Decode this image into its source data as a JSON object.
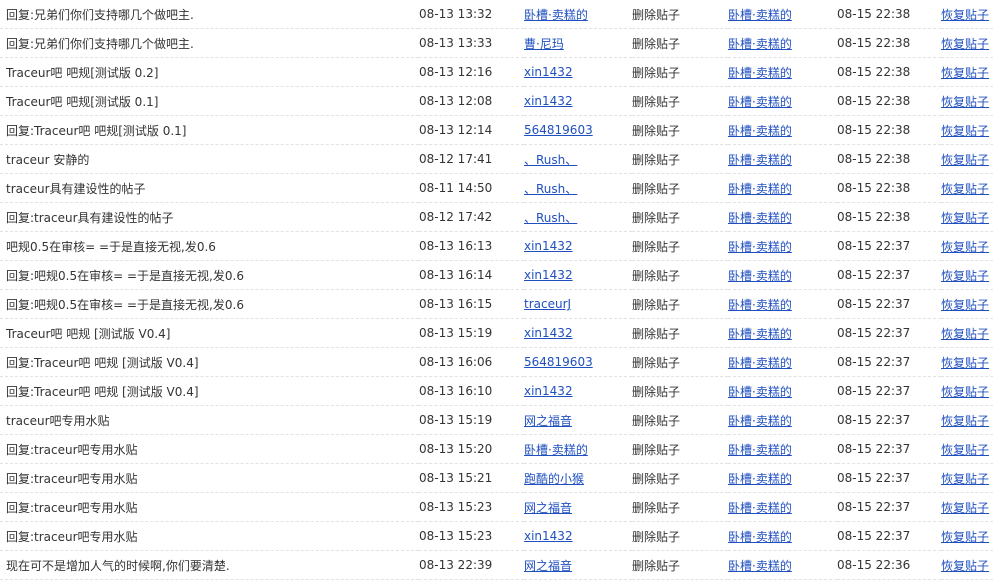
{
  "rows": [
    {
      "title": "回复:兄弟们你们支持哪几个做吧主.",
      "post_time": "08-13 13:32",
      "author": "卧槽·卖糕的",
      "action": "删除贴子",
      "operator": "卧槽·卖糕的",
      "op_time": "08-15 22:38",
      "restore": "恢复贴子"
    },
    {
      "title": "回复:兄弟们你们支持哪几个做吧主.",
      "post_time": "08-13 13:33",
      "author": "曹·尼玛",
      "action": "删除贴子",
      "operator": "卧槽·卖糕的",
      "op_time": "08-15 22:38",
      "restore": "恢复贴子"
    },
    {
      "title": "Traceur吧 吧规[测试版 0.2]",
      "post_time": "08-13 12:16",
      "author": "xin1432",
      "action": "删除贴子",
      "operator": "卧槽·卖糕的",
      "op_time": "08-15 22:38",
      "restore": "恢复贴子"
    },
    {
      "title": "Traceur吧 吧规[测试版 0.1]",
      "post_time": "08-13 12:08",
      "author": "xin1432",
      "action": "删除贴子",
      "operator": "卧槽·卖糕的",
      "op_time": "08-15 22:38",
      "restore": "恢复贴子"
    },
    {
      "title": "回复:Traceur吧 吧规[测试版 0.1]",
      "post_time": "08-13 12:14",
      "author": "564819603",
      "action": "删除贴子",
      "operator": "卧槽·卖糕的",
      "op_time": "08-15 22:38",
      "restore": "恢复贴子"
    },
    {
      "title": "traceur 安静的",
      "post_time": "08-12 17:41",
      "author": "、Rush、",
      "action": "删除贴子",
      "operator": "卧槽·卖糕的",
      "op_time": "08-15 22:38",
      "restore": "恢复贴子"
    },
    {
      "title": "traceur具有建设性的帖子",
      "post_time": "08-11 14:50",
      "author": "、Rush、",
      "action": "删除贴子",
      "operator": "卧槽·卖糕的",
      "op_time": "08-15 22:38",
      "restore": "恢复贴子"
    },
    {
      "title": "回复:traceur具有建设性的帖子",
      "post_time": "08-12 17:42",
      "author": "、Rush、",
      "action": "删除贴子",
      "operator": "卧槽·卖糕的",
      "op_time": "08-15 22:38",
      "restore": "恢复贴子"
    },
    {
      "title": "吧规0.5在审核= =于是直接无视,发0.6",
      "post_time": "08-13 16:13",
      "author": "xin1432",
      "action": "删除贴子",
      "operator": "卧槽·卖糕的",
      "op_time": "08-15 22:37",
      "restore": "恢复贴子"
    },
    {
      "title": "回复:吧规0.5在审核= =于是直接无视,发0.6",
      "post_time": "08-13 16:14",
      "author": "xin1432",
      "action": "删除贴子",
      "operator": "卧槽·卖糕的",
      "op_time": "08-15 22:37",
      "restore": "恢复贴子"
    },
    {
      "title": "回复:吧规0.5在审核= =于是直接无视,发0.6",
      "post_time": "08-13 16:15",
      "author": "traceurJ",
      "action": "删除贴子",
      "operator": "卧槽·卖糕的",
      "op_time": "08-15 22:37",
      "restore": "恢复贴子"
    },
    {
      "title": "Traceur吧 吧规 [测试版 V0.4]",
      "post_time": "08-13 15:19",
      "author": "xin1432",
      "action": "删除贴子",
      "operator": "卧槽·卖糕的",
      "op_time": "08-15 22:37",
      "restore": "恢复贴子"
    },
    {
      "title": "回复:Traceur吧 吧规 [测试版 V0.4]",
      "post_time": "08-13 16:06",
      "author": "564819603",
      "action": "删除贴子",
      "operator": "卧槽·卖糕的",
      "op_time": "08-15 22:37",
      "restore": "恢复贴子"
    },
    {
      "title": "回复:Traceur吧 吧规 [测试版 V0.4]",
      "post_time": "08-13 16:10",
      "author": "xin1432",
      "action": "删除贴子",
      "operator": "卧槽·卖糕的",
      "op_time": "08-15 22:37",
      "restore": "恢复贴子"
    },
    {
      "title": "traceur吧专用水贴",
      "post_time": "08-13 15:19",
      "author": "网之福音",
      "action": "删除贴子",
      "operator": "卧槽·卖糕的",
      "op_time": "08-15 22:37",
      "restore": "恢复贴子"
    },
    {
      "title": "回复:traceur吧专用水贴",
      "post_time": "08-13 15:20",
      "author": "卧槽·卖糕的",
      "action": "删除贴子",
      "operator": "卧槽·卖糕的",
      "op_time": "08-15 22:37",
      "restore": "恢复贴子"
    },
    {
      "title": "回复:traceur吧专用水贴",
      "post_time": "08-13 15:21",
      "author": "跑酷的小猴",
      "action": "删除贴子",
      "operator": "卧槽·卖糕的",
      "op_time": "08-15 22:37",
      "restore": "恢复贴子"
    },
    {
      "title": "回复:traceur吧专用水贴",
      "post_time": "08-13 15:23",
      "author": "网之福音",
      "action": "删除贴子",
      "operator": "卧槽·卖糕的",
      "op_time": "08-15 22:37",
      "restore": "恢复贴子"
    },
    {
      "title": "回复:traceur吧专用水贴",
      "post_time": "08-13 15:23",
      "author": "xin1432",
      "action": "删除贴子",
      "operator": "卧槽·卖糕的",
      "op_time": "08-15 22:37",
      "restore": "恢复贴子"
    },
    {
      "title": "现在可不是增加人气的时候啊,你们要清楚.",
      "post_time": "08-13 22:39",
      "author": "网之福音",
      "action": "删除贴子",
      "operator": "卧槽·卖糕的",
      "op_time": "08-15 22:36",
      "restore": "恢复贴子"
    }
  ],
  "colors": {
    "link": "#2050c0",
    "text": "#333333",
    "row_divider": "#e2e2e2"
  }
}
